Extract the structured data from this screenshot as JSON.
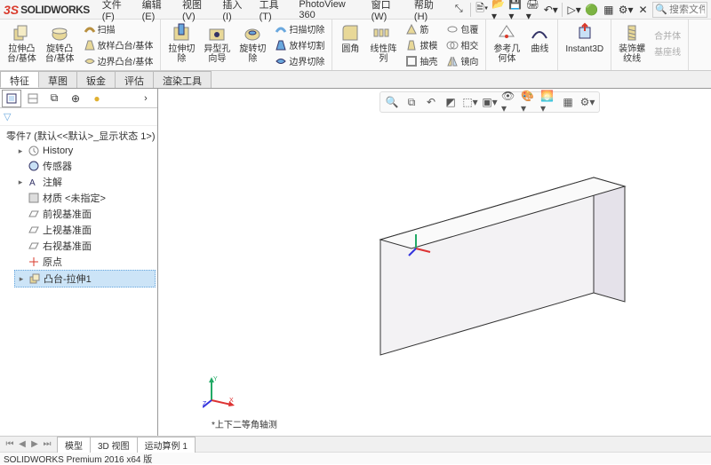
{
  "app": {
    "name": "SOLIDWORKS"
  },
  "menu": {
    "file": "文件(F)",
    "edit": "编辑(E)",
    "view": "视图(V)",
    "insert": "插入(I)",
    "tools": "工具(T)",
    "photoview": "PhotoView 360",
    "window": "窗口(W)",
    "help": "帮助(H)"
  },
  "search": {
    "placeholder": "搜索文件"
  },
  "ribbon": {
    "extrude": "拉伸凸\n台/基体",
    "revolve": "旋转凸\n台/基体",
    "sweep": "扫描",
    "loft": "放样凸台/基体",
    "boundary": "边界凸台/基体",
    "extrude_cut": "拉伸切\n除",
    "wizard_hole": "异型孔\n向导",
    "revolve_cut": "旋转切\n除",
    "sweep_cut": "扫描切除",
    "loft_cut": "放样切割",
    "boundary_cut": "边界切除",
    "fillet": "圆角",
    "linear_pattern": "线性阵\n列",
    "rib": "筋",
    "draft": "拔模",
    "shell": "抽壳",
    "wrap": "包覆",
    "intersect": "相交",
    "mirror": "镜向",
    "ref_geom": "参考几\n何体",
    "curves": "曲线",
    "instant3d": "Instant3D",
    "decor_thread": "装饰螺\n纹线",
    "combine_disabled": "合并体",
    "base_path_disabled": "基座线"
  },
  "tabs": {
    "feature": "特征",
    "sketch": "草图",
    "sheetmetal": "钣金",
    "evaluate": "评估",
    "render": "渲染工具"
  },
  "tree": {
    "root": "零件7 (默认<<默认>_显示状态 1>)",
    "history": "History",
    "sensor": "传感器",
    "annotations": "注解",
    "material": "材质 <未指定>",
    "front": "前视基准面",
    "top": "上视基准面",
    "right": "右视基准面",
    "origin": "原点",
    "feat1": "凸台-拉伸1"
  },
  "viewport": {
    "orientation_label": "*上下二等角轴测"
  },
  "bottom_tabs": {
    "model": "模型",
    "view3d": "3D 视图",
    "motion": "运动算例 1"
  },
  "status": "SOLIDWORKS Premium 2016 x64 版"
}
